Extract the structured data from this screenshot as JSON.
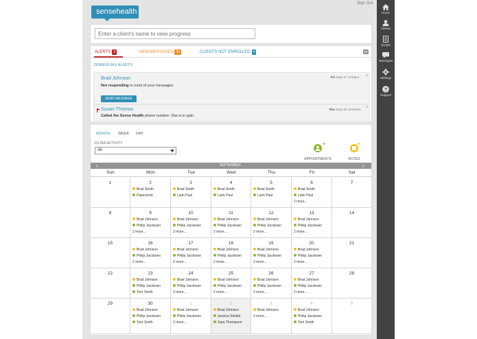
{
  "app": {
    "logo_text": "sensehealth",
    "signout_label": "Sign Out"
  },
  "nav": [
    {
      "label": "Home",
      "icon": "home-icon"
    },
    {
      "label": "Clients",
      "icon": "user-icon"
    },
    {
      "label": "Scripts",
      "icon": "document-icon"
    },
    {
      "label": "Messages",
      "icon": "chat-icon"
    },
    {
      "label": "Settings",
      "icon": "gear-icon"
    },
    {
      "label": "Support",
      "icon": "help-icon"
    }
  ],
  "search": {
    "placeholder": "Enter a client's name to view progress"
  },
  "alerts": {
    "tabs": [
      {
        "label": "ALERTS",
        "count": "2",
        "color": "#c1272d",
        "badge_color": "#c1272d"
      },
      {
        "label": "NEW MESSAGES",
        "count": "20",
        "color": "#f08a24",
        "badge_color": "#f08a24"
      },
      {
        "label": "CLIENTS NOT ENROLLED",
        "count": "4",
        "color": "#2f8fb6",
        "badge_color": "#2f8fb6"
      }
    ],
    "dismiss_label": "DISMISS ALL ALERTS",
    "items": [
      {
        "name": "Brad Johnson",
        "text_bold": "Not responding",
        "text_rest": " to most of your messages.",
        "date_day": "Fri",
        "date_rest": " Sept 27 3:00pm",
        "action_label": "SEND MESSAGE"
      },
      {
        "name": "Susan Thomas",
        "text_bold": "Called the Sense Health",
        "text_rest": " phone number. She is in pain.",
        "date_day": "Thu",
        "date_rest": " Sept 26 10:00am"
      }
    ]
  },
  "calendar": {
    "views": [
      "MONTH",
      "WEEK",
      "DAY"
    ],
    "active_view": "MONTH",
    "filter_label": "FILTER ACTIVITY",
    "filter_value": "All",
    "appointments_label": "APPOINTMENTS",
    "notes_label": "NOTES",
    "month_label": "SEPTEMBER",
    "prev_glyph": "‹",
    "next_glyph": "›",
    "days_of_week": [
      "Sun",
      "Mon",
      "Tue",
      "Wed",
      "Thu",
      "Fri",
      "Sat"
    ],
    "colors": {
      "yellow": "#f2c41b",
      "green": "#8bb82a",
      "brand": "#2f8fb6",
      "alert": "#c1272d"
    },
    "weeks": [
      [
        {
          "day": "1",
          "events": []
        },
        {
          "day": "2",
          "events": [
            {
              "text": "Brad Smith",
              "c": "yellow"
            },
            {
              "text": "Paperwork",
              "c": "green"
            }
          ]
        },
        {
          "day": "3",
          "events": [
            {
              "text": "Brad Smith",
              "c": "yellow"
            },
            {
              "text": "Liam Paul",
              "c": "green"
            }
          ]
        },
        {
          "day": "4",
          "events": [
            {
              "text": "Brad Smith",
              "c": "yellow"
            },
            {
              "text": "Liam Paul",
              "c": "green"
            }
          ]
        },
        {
          "day": "5",
          "events": [
            {
              "text": "Brad Smith",
              "c": "yellow"
            },
            {
              "text": "Liam Paul",
              "c": "green"
            }
          ]
        },
        {
          "day": "6",
          "events": [
            {
              "text": "Brad Smith",
              "c": "yellow"
            },
            {
              "text": "Liam Paul",
              "c": "green"
            },
            {
              "text": "2 more...",
              "c": ""
            }
          ]
        },
        {
          "day": "7",
          "events": []
        }
      ],
      [
        {
          "day": "8",
          "events": []
        },
        {
          "day": "9",
          "events": [
            {
              "text": "Brad Johnson",
              "c": "yellow"
            },
            {
              "text": "Philip Jacobsen",
              "c": "green"
            },
            {
              "text": "2 more...",
              "c": ""
            }
          ]
        },
        {
          "day": "10",
          "events": [
            {
              "text": "Brad Johnson",
              "c": "yellow"
            },
            {
              "text": "Philip Jacobsen",
              "c": "green"
            },
            {
              "text": "2 more...",
              "c": ""
            }
          ]
        },
        {
          "day": "11",
          "events": [
            {
              "text": "Brad Johnson",
              "c": "yellow"
            },
            {
              "text": "Philip Jacobsen",
              "c": "green"
            },
            {
              "text": "2 more...",
              "c": ""
            }
          ]
        },
        {
          "day": "12",
          "events": [
            {
              "text": "Brad Johnson",
              "c": "yellow"
            },
            {
              "text": "Philip Jacobsen",
              "c": "green"
            },
            {
              "text": "2 more...",
              "c": ""
            }
          ]
        },
        {
          "day": "13",
          "events": [
            {
              "text": "Brad Johnson",
              "c": "yellow"
            },
            {
              "text": "Philip Jacobsen",
              "c": "green"
            },
            {
              "text": "2 more...",
              "c": ""
            }
          ]
        },
        {
          "day": "14",
          "events": []
        }
      ],
      [
        {
          "day": "15",
          "events": []
        },
        {
          "day": "16",
          "events": [
            {
              "text": "Brad Johnson",
              "c": "yellow"
            },
            {
              "text": "Philip Jacobsen",
              "c": "green"
            },
            {
              "text": "2 more...",
              "c": ""
            }
          ]
        },
        {
          "day": "17",
          "events": [
            {
              "text": "Brad Johnson",
              "c": "yellow"
            },
            {
              "text": "Philip Jacobsen",
              "c": "green"
            },
            {
              "text": "2 more...",
              "c": ""
            }
          ]
        },
        {
          "day": "18",
          "events": [
            {
              "text": "Brad Johnson",
              "c": "yellow"
            },
            {
              "text": "Philip Jacobsen",
              "c": "green"
            },
            {
              "text": "2 more...",
              "c": ""
            }
          ]
        },
        {
          "day": "19",
          "events": [
            {
              "text": "Brad Johnson",
              "c": "yellow"
            },
            {
              "text": "Philip Jacobsen",
              "c": "green"
            },
            {
              "text": "2 more...",
              "c": ""
            }
          ]
        },
        {
          "day": "20",
          "events": [
            {
              "text": "Brad Johnson",
              "c": "yellow"
            },
            {
              "text": "Philip Jacobsen",
              "c": "green"
            },
            {
              "text": "2 more...",
              "c": ""
            }
          ]
        },
        {
          "day": "21",
          "events": []
        }
      ],
      [
        {
          "day": "22",
          "events": []
        },
        {
          "day": "23",
          "events": [
            {
              "text": "Brad Johnson",
              "c": "yellow"
            },
            {
              "text": "Philip Jacobsen",
              "c": "green"
            },
            {
              "text": "Tom Smith",
              "c": "green"
            }
          ]
        },
        {
          "day": "24",
          "events": [
            {
              "text": "Brad Johnson",
              "c": "yellow"
            },
            {
              "text": "Philip Jacobsen",
              "c": "green"
            },
            {
              "text": "2 more...",
              "c": ""
            }
          ]
        },
        {
          "day": "25",
          "events": [
            {
              "text": "Brad Johnson",
              "c": "yellow"
            },
            {
              "text": "Philip Jacobsen",
              "c": "green"
            },
            {
              "text": "2 more...",
              "c": ""
            }
          ]
        },
        {
          "day": "26",
          "events": [
            {
              "text": "Brad Johnson",
              "c": "yellow"
            },
            {
              "text": "Philip Jacobsen",
              "c": "green"
            },
            {
              "text": "2 more...",
              "c": ""
            }
          ]
        },
        {
          "day": "27",
          "events": [
            {
              "text": "Brad Johnson",
              "c": "yellow"
            },
            {
              "text": "Philip Jacobsen",
              "c": "green"
            },
            {
              "text": "2 more...",
              "c": ""
            }
          ]
        },
        {
          "day": "28",
          "events": []
        }
      ],
      [
        {
          "day": "29",
          "events": []
        },
        {
          "day": "30",
          "events": [
            {
              "text": "Brad Johnson",
              "c": "yellow"
            },
            {
              "text": "Philip Jacobsen",
              "c": "green"
            },
            {
              "text": "Tom Smith",
              "c": "green"
            }
          ]
        },
        {
          "day": "1",
          "faded": true,
          "events": [
            {
              "text": "Brad Johnson",
              "c": "yellow"
            },
            {
              "text": "Philip Jacobsen",
              "c": "green"
            },
            {
              "text": "2 more...",
              "c": ""
            }
          ]
        },
        {
          "day": "2",
          "faded": true,
          "grey": true,
          "events": [
            {
              "text": "Brad Johnson",
              "c": "yellow"
            },
            {
              "text": "Jessica Steidel",
              "c": "green"
            },
            {
              "text": "Sara Thompson",
              "c": "green"
            }
          ]
        },
        {
          "day": "3",
          "faded": true,
          "events": [
            {
              "text": "Brad Johnson",
              "c": "yellow"
            },
            {
              "text": "2 more...",
              "c": ""
            }
          ]
        },
        {
          "day": "4",
          "faded": true,
          "events": [
            {
              "text": "Brad Johnson",
              "c": "yellow"
            },
            {
              "text": "Philip Jacobsen",
              "c": "green"
            },
            {
              "text": "Tom Smith",
              "c": "green"
            }
          ]
        },
        {
          "day": "5",
          "faded": true,
          "events": []
        }
      ]
    ]
  }
}
